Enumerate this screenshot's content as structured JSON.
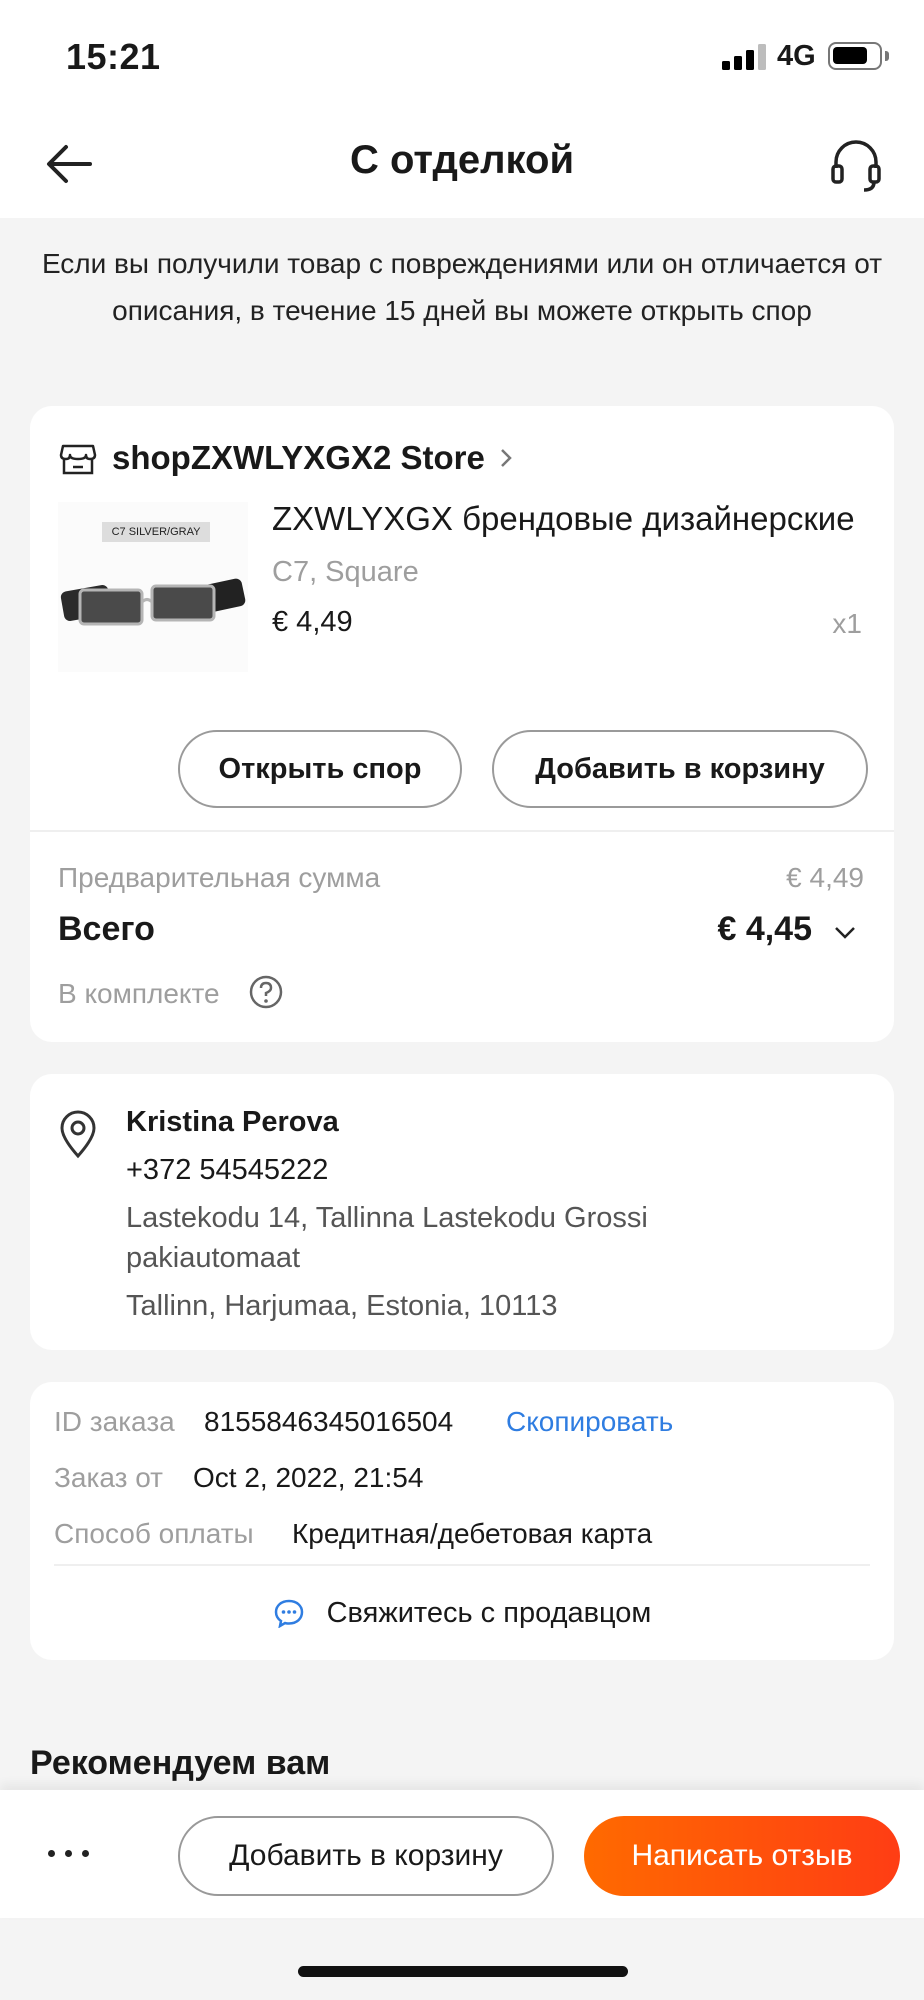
{
  "status_bar": {
    "time": "15:21",
    "network": "4G",
    "battery_level": 0.7
  },
  "nav": {
    "title": "С отделкой",
    "back_icon": "arrow-left-icon",
    "support_icon": "headset-icon"
  },
  "notice": "Если вы получили товар с повреждениями или он отличается от описания, в течение 15 дней вы можете открыть спор",
  "order_card": {
    "store_name": "shopZXWLYXGX2 Store",
    "store_icon": "store-icon",
    "product": {
      "image_tag": "C7 SILVER/GRAY",
      "title": "ZXWLYXGX брендовые дизайнерские",
      "variant": "C7, Square",
      "price": "€ 4,49",
      "quantity": "x1"
    },
    "buttons": {
      "dispute": "Открыть спор",
      "add_to_cart": "Добавить в корзину"
    },
    "subtotal_label": "Предварительная сумма",
    "subtotal_value": "€ 4,49",
    "total_label": "Всего",
    "total_value": "€ 4,45",
    "included_label": "В комплекте"
  },
  "address": {
    "name": "Kristina Perova",
    "phone": "+372 54545222",
    "line1": "Lastekodu 14, Tallinna Lastekodu Grossi",
    "line2": "pakiautomaat",
    "line3": "Tallinn, Harjumaa, Estonia, 10113"
  },
  "order_info": {
    "id_label": "ID заказа",
    "id_value": "8155846345016504",
    "copy_label": "Скопировать",
    "date_label": "Заказ от",
    "date_value": "Oct 2, 2022, 21:54",
    "payment_label": "Способ оплаты",
    "payment_value": "Кредитная/дебетовая карта",
    "contact_label": "Свяжитесь с продавцом"
  },
  "recommend_title": "Рекомендуем вам",
  "bottom_bar": {
    "add_to_cart": "Добавить в корзину",
    "write_review": "Написать отзыв"
  },
  "colors": {
    "accent": "#ff4f0f",
    "link": "#2f7de1"
  }
}
